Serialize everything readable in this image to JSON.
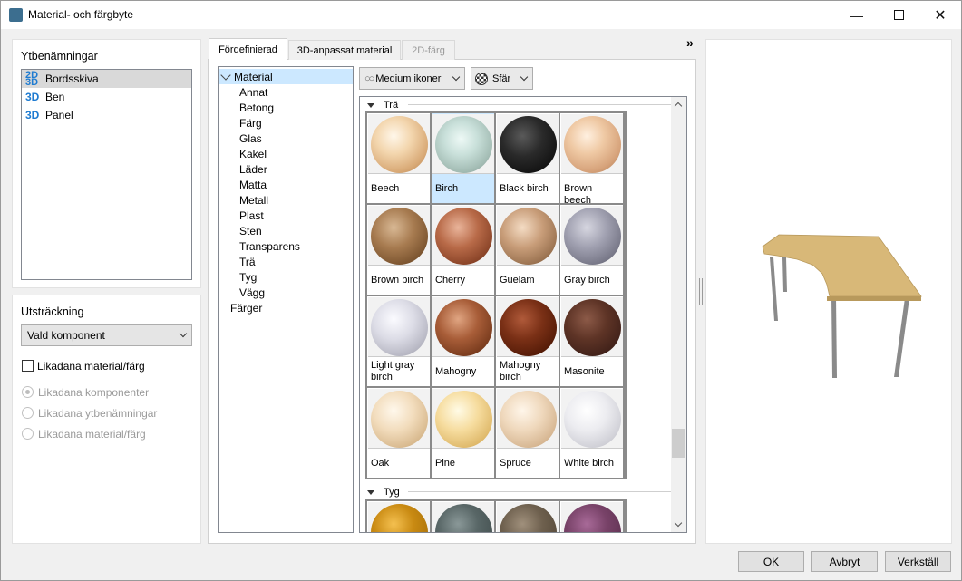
{
  "window": {
    "title": "Material- och färgbyte"
  },
  "surfaces": {
    "heading": "Ytbenämningar",
    "items": [
      {
        "tag": "2D 3D",
        "label": "Bordsskiva",
        "selected": true
      },
      {
        "tag": "3D",
        "label": "Ben",
        "selected": false
      },
      {
        "tag": "3D",
        "label": "Panel",
        "selected": false
      }
    ]
  },
  "extent": {
    "heading": "Utsträckning",
    "select_value": "Vald komponent",
    "checkbox_label": "Likadana material/färg",
    "radio_1": "Likadana komponenter",
    "radio_2": "Likadana ytbenämningar",
    "radio_3": "Likadana material/färg"
  },
  "tabs": {
    "t1": "Fördefinierad",
    "t2": "3D-anpassat material",
    "t3": "2D-färg"
  },
  "tree": {
    "root": "Material",
    "children": [
      "Annat",
      "Betong",
      "Färg",
      "Glas",
      "Kakel",
      "Läder",
      "Matta",
      "Metall",
      "Plast",
      "Sten",
      "Transparens",
      "Trä",
      "Tyg",
      "Vägg"
    ],
    "colors": "Färger"
  },
  "toolbar": {
    "view_label": "Medium ikoner",
    "shape_label": "Sfär"
  },
  "groups": {
    "wood": "Trä",
    "fabric": "Tyg"
  },
  "materials": {
    "beech": "Beech",
    "birch": "Birch",
    "black_birch": "Black birch",
    "brown_beech": "Brown beech",
    "brown_birch": "Brown birch",
    "cherry": "Cherry",
    "guelam": "Guelam",
    "gray_birch": "Gray birch",
    "light_gray_birch": "Light gray birch",
    "mahogny": "Mahogny",
    "mahogny_birch": "Mahogny birch",
    "masonite": "Masonite",
    "oak": "Oak",
    "pine": "Pine",
    "spruce": "Spruce",
    "white_birch": "White birch"
  },
  "buttons": {
    "ok": "OK",
    "cancel": "Avbryt",
    "apply": "Verkställ"
  },
  "colors": {
    "selection": "#cce8ff",
    "tag_blue": "#1e7bd1",
    "table_top": "#d8b878"
  }
}
